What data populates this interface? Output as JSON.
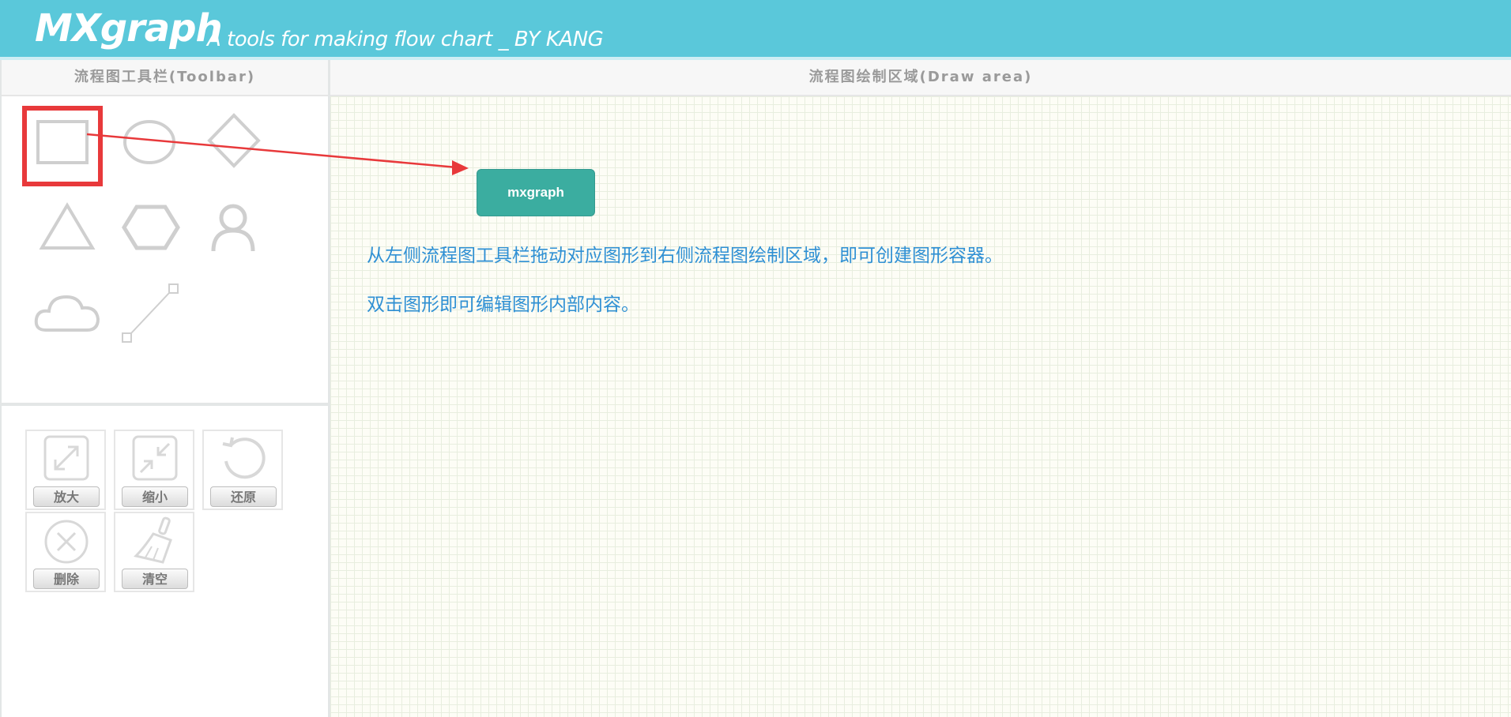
{
  "header": {
    "logo": "MXgraph",
    "tagline": "A tools for making flow chart _ BY KANG",
    "background_color": "#5ac8da"
  },
  "toolbar": {
    "title": "流程图工具栏(Toolbar)",
    "shapes": [
      {
        "name": "rectangle",
        "icon": "rectangle-icon",
        "selected": true
      },
      {
        "name": "ellipse",
        "icon": "ellipse-icon",
        "selected": false
      },
      {
        "name": "rhombus",
        "icon": "rhombus-icon",
        "selected": false
      },
      {
        "name": "triangle",
        "icon": "triangle-icon",
        "selected": false
      },
      {
        "name": "hexagon",
        "icon": "hexagon-icon",
        "selected": false
      },
      {
        "name": "actor",
        "icon": "person-icon",
        "selected": false
      },
      {
        "name": "cloud",
        "icon": "cloud-icon",
        "selected": false
      },
      {
        "name": "line",
        "icon": "line-connector-icon",
        "selected": false
      }
    ],
    "controls": {
      "zoom_in": {
        "label": "放大",
        "icon": "expand-icon"
      },
      "zoom_out": {
        "label": "缩小",
        "icon": "shrink-icon"
      },
      "reset": {
        "label": "还原",
        "icon": "undo-icon"
      },
      "delete": {
        "label": "删除",
        "icon": "close-circle-icon"
      },
      "clear": {
        "label": "清空",
        "icon": "broom-icon"
      }
    }
  },
  "draw_area": {
    "title": "流程图绘制区域(Draw area)",
    "node_label": "mxgraph",
    "instruction_1": "从左侧流程图工具栏拖动对应图形到右侧流程图绘制区域，即可创建图形容器。",
    "instruction_2": "双击图形即可编辑图形内部内容。",
    "instruction_color": "#2f90d4",
    "node_color": "#3bada0"
  },
  "annotation": {
    "highlight_color": "#e8393b"
  }
}
